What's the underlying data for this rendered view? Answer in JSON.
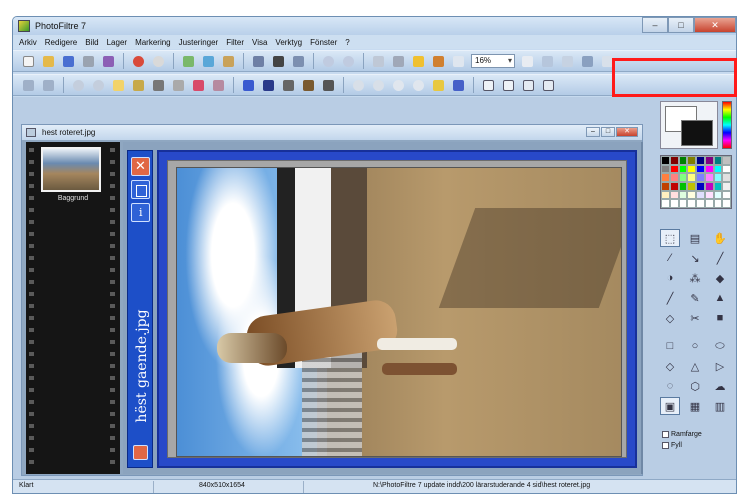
{
  "app": {
    "title": "PhotoFiltre 7"
  },
  "menu": [
    "Arkiv",
    "Redigere",
    "Bild",
    "Lager",
    "Markering",
    "Justeringer",
    "Filter",
    "Visa",
    "Verktyg",
    "Fönster",
    "?"
  ],
  "toolbar": {
    "zoom_value": "16%"
  },
  "document": {
    "title": "hest roteret.jpg",
    "layer_label": "Baggrund",
    "vertical_caption": "hëst gaende.jpg"
  },
  "tool_options": {
    "frame_label": "Ramfarge",
    "fill_label": "Fyll"
  },
  "status": {
    "state": "Klart",
    "dimensions": "840x510x1654",
    "path": "N:\\PhotoFiltre 7 update indd\\200 lärarstuderande 4 sid\\hest roteret.jpg"
  },
  "colors": {
    "highlight": "#ff1a1a",
    "panel_blue": "#1d4fc8"
  }
}
